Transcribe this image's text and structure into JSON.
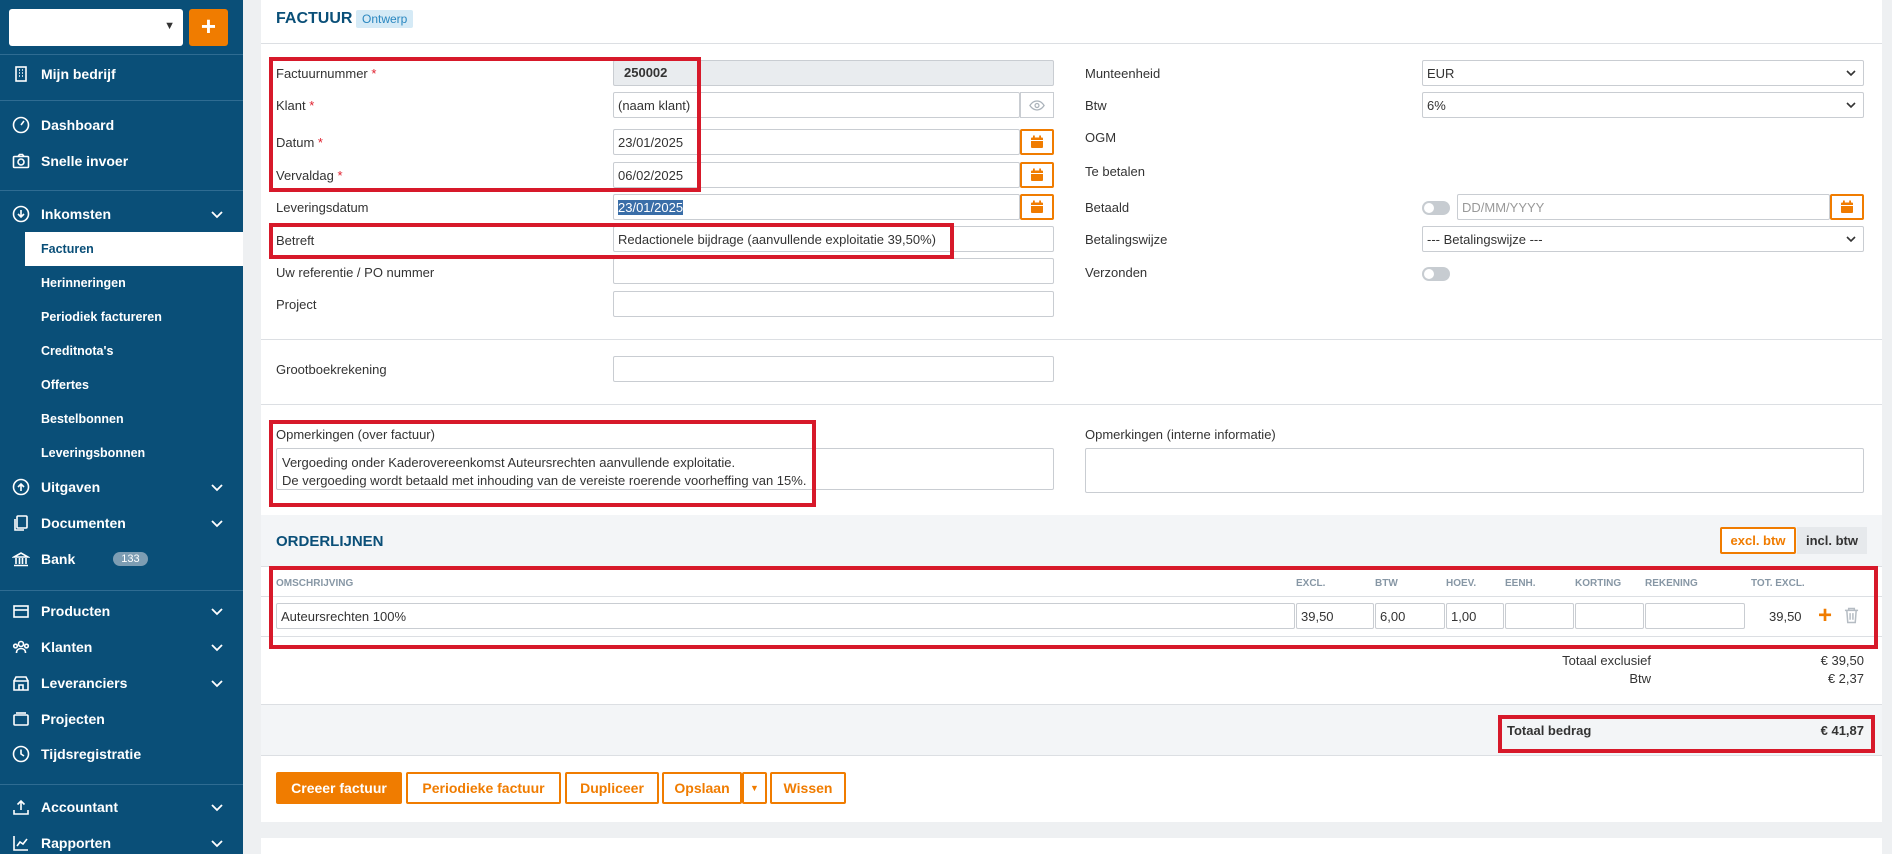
{
  "sidebar": {
    "items": [
      {
        "key": "company",
        "label": "Mijn bedrijf"
      },
      {
        "key": "dashboard",
        "label": "Dashboard"
      },
      {
        "key": "quick",
        "label": "Snelle invoer"
      },
      {
        "key": "income",
        "label": "Inkomsten"
      },
      {
        "key": "expenses",
        "label": "Uitgaven"
      },
      {
        "key": "documents",
        "label": "Documenten"
      },
      {
        "key": "bank",
        "label": "Bank",
        "badge": "133"
      },
      {
        "key": "products",
        "label": "Producten"
      },
      {
        "key": "clients",
        "label": "Klanten"
      },
      {
        "key": "suppliers",
        "label": "Leveranciers"
      },
      {
        "key": "projects",
        "label": "Projecten"
      },
      {
        "key": "time",
        "label": "Tijdsregistratie"
      },
      {
        "key": "accountant",
        "label": "Accountant"
      },
      {
        "key": "reports",
        "label": "Rapporten"
      }
    ],
    "income_sub": [
      "Facturen",
      "Herinneringen",
      "Periodiek factureren",
      "Creditnota's",
      "Offertes",
      "Bestelbonnen",
      "Leveringsbonnen"
    ]
  },
  "header": {
    "title": "FACTUUR",
    "status": "Ontwerp"
  },
  "form": {
    "invoice_number_label": "Factuurnummer",
    "invoice_number": "250002",
    "client_label": "Klant",
    "client_value": "(naam klant)",
    "date_label": "Datum",
    "date_value": "23/01/2025",
    "due_label": "Vervaldag",
    "due_value": "06/02/2025",
    "delivery_label": "Leveringsdatum",
    "delivery_value": "23/01/2025",
    "subject_label": "Betreft",
    "subject_value": "Redactionele bijdrage (aanvullende exploitatie 39,50%)",
    "reference_label": "Uw referentie / PO nummer",
    "project_label": "Project",
    "ledger_label": "Grootboekrekening",
    "currency_label": "Munteenheid",
    "currency_value": "EUR",
    "vat_label": "Btw",
    "vat_value": "6%",
    "ogm_label": "OGM",
    "to_pay_label": "Te betalen",
    "paid_label": "Betaald",
    "paid_placeholder": "DD/MM/YYYY",
    "payment_method_label": "Betalingswijze",
    "payment_method_value": "--- Betalingswijze ---",
    "sent_label": "Verzonden",
    "remarks_label": "Opmerkingen (over factuur)",
    "remarks_line1": "Vergoeding onder Kaderovereenkomst Auteursrechten aanvullende exploitatie.",
    "remarks_line2": "De vergoeding wordt betaald met inhouding van de vereiste roerende voorheffing van 15%.",
    "internal_remarks_label": "Opmerkingen (interne informatie)"
  },
  "orderlines": {
    "title": "ORDERLIJNEN",
    "toggle_excl": "excl. btw",
    "toggle_incl": "incl. btw",
    "columns": [
      "OMSCHRIJVING",
      "EXCL.",
      "BTW",
      "HOEV.",
      "EENH.",
      "KORTING",
      "REKENING",
      "TOT. EXCL."
    ],
    "row": {
      "description": "Auteursrechten 100%",
      "excl": "39,50",
      "vat": "6,00",
      "qty": "1,00",
      "total": "39,50"
    }
  },
  "totals": {
    "excl_label": "Totaal exclusief",
    "excl_value": "€ 39,50",
    "vat_label": "Btw",
    "vat_value": "€ 2,37",
    "total_label": "Totaal bedrag",
    "total_value": "€ 41,87"
  },
  "actions": {
    "create": "Creeer factuur",
    "periodic": "Periodieke factuur",
    "duplicate": "Dupliceer",
    "save": "Opslaan",
    "clear": "Wissen"
  },
  "colors": {
    "brand": "#0a4f78",
    "accent": "#f07c00",
    "highlight": "#d7192a"
  }
}
